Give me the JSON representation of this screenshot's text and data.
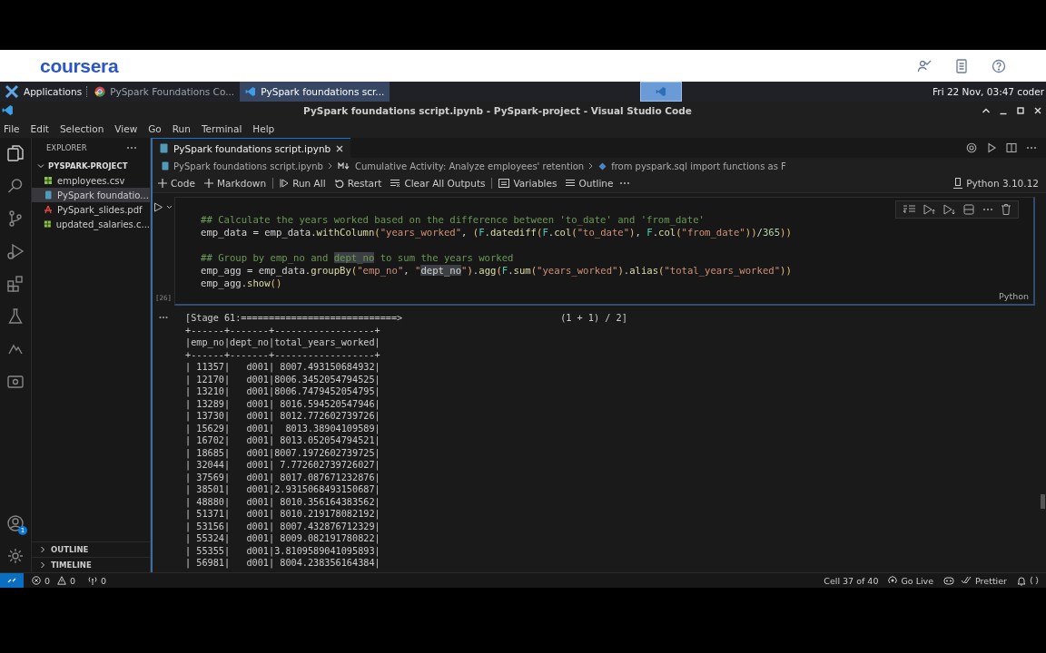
{
  "header": {
    "logo": "coursera"
  },
  "taskbar": {
    "apps_label": "Applications",
    "tasks": [
      {
        "label": "PySpark Foundations Co...",
        "kind": "browser",
        "selected": false
      },
      {
        "label": "PySpark foundations scr...",
        "kind": "editor",
        "selected": true
      }
    ],
    "clock": "Fri 22 Nov, 03:47 coder"
  },
  "window": {
    "title": "PySpark foundations script.ipynb - PySpark-project - Visual Studio Code"
  },
  "menu": [
    "File",
    "Edit",
    "Selection",
    "View",
    "Go",
    "Run",
    "Terminal",
    "Help"
  ],
  "activity_bar": {
    "account_badge": "1"
  },
  "sidebar": {
    "header": "EXPLORER",
    "project": "PYSPARK-PROJECT",
    "files": [
      {
        "name": "employees.csv",
        "kind": "csv",
        "selected": false
      },
      {
        "name": "PySpark foundatio...",
        "kind": "notebook",
        "selected": true
      },
      {
        "name": "PySpark_slides.pdf",
        "kind": "pdf",
        "selected": false
      },
      {
        "name": "updated_salaries.c...",
        "kind": "csv",
        "selected": false
      }
    ],
    "sections": [
      "OUTLINE",
      "TIMELINE"
    ]
  },
  "tabs": [
    {
      "label": "PySpark foundations script.ipynb",
      "selected": true
    }
  ],
  "breadcrumb": [
    "PySpark foundations script.ipynb",
    "Cumulative Activity: Analyze employees' retention",
    "from pyspark.sql import functions as F"
  ],
  "toolbar": [
    {
      "label": "Code",
      "kind": "plus"
    },
    {
      "label": "Markdown",
      "kind": "plus"
    },
    {
      "label": "Run All",
      "kind": "run"
    },
    {
      "label": "Restart",
      "kind": "restart"
    },
    {
      "label": "Clear All Outputs",
      "kind": "clear"
    },
    {
      "label": "Variables",
      "kind": "variables"
    },
    {
      "label": "Outline",
      "kind": "outline"
    }
  ],
  "kernel": "Python 3.10.12",
  "cell": {
    "execution_count": "[26]",
    "language": "Python",
    "code_blocks": [
      [
        [
          {
            "text": "## Calculate the years worked based on the difference between 'to_date' and 'from_date'",
            "kind": "comment"
          }
        ],
        [
          {
            "text": "emp_data = emp_data.",
            "kind": "plain"
          },
          {
            "text": "withColumn",
            "kind": "function"
          },
          {
            "text": "(",
            "kind": "bracket"
          },
          {
            "text": "\"years_worked\"",
            "kind": "string"
          },
          {
            "text": ", ",
            "kind": "plain"
          },
          {
            "text": "(",
            "kind": "bracket"
          },
          {
            "text": "F",
            "kind": "module"
          },
          {
            "text": ".",
            "kind": "plain"
          },
          {
            "text": "datediff",
            "kind": "function"
          },
          {
            "text": "(",
            "kind": "bracket"
          },
          {
            "text": "F",
            "kind": "module"
          },
          {
            "text": ".",
            "kind": "plain"
          },
          {
            "text": "col",
            "kind": "function"
          },
          {
            "text": "(",
            "kind": "bracket"
          },
          {
            "text": "\"to_date\"",
            "kind": "string"
          },
          {
            "text": ")",
            "kind": "bracket"
          },
          {
            "text": ", ",
            "kind": "plain"
          },
          {
            "text": "F",
            "kind": "module"
          },
          {
            "text": ".",
            "kind": "plain"
          },
          {
            "text": "col",
            "kind": "function"
          },
          {
            "text": "(",
            "kind": "bracket"
          },
          {
            "text": "\"from_date\"",
            "kind": "string"
          },
          {
            "text": "))",
            "kind": "bracket"
          },
          {
            "text": "/",
            "kind": "plain"
          },
          {
            "text": "365",
            "kind": "number"
          },
          {
            "text": "))",
            "kind": "bracket"
          }
        ]
      ],
      [
        [
          {
            "text": "## Group by emp_no and ",
            "kind": "comment"
          },
          {
            "text": "dept_no",
            "kind": "match-comment"
          },
          {
            "text": " to sum the years worked",
            "kind": "comment"
          }
        ],
        [
          {
            "text": "emp_agg = emp_data.",
            "kind": "plain"
          },
          {
            "text": "groupBy",
            "kind": "function"
          },
          {
            "text": "(",
            "kind": "bracket"
          },
          {
            "text": "\"emp_no\"",
            "kind": "string"
          },
          {
            "text": ", ",
            "kind": "plain"
          },
          {
            "text": "\"",
            "kind": "string"
          },
          {
            "text": "dept_no",
            "kind": "match-string"
          },
          {
            "text": "\"",
            "kind": "string"
          },
          {
            "text": ")",
            "kind": "bracket"
          },
          {
            "text": ".",
            "kind": "plain"
          },
          {
            "text": "agg",
            "kind": "function"
          },
          {
            "text": "(",
            "kind": "bracket"
          },
          {
            "text": "F",
            "kind": "module"
          },
          {
            "text": ".",
            "kind": "plain"
          },
          {
            "text": "sum",
            "kind": "function"
          },
          {
            "text": "(",
            "kind": "bracket"
          },
          {
            "text": "\"years_worked\"",
            "kind": "string"
          },
          {
            "text": ")",
            "kind": "bracket"
          },
          {
            "text": ".",
            "kind": "plain"
          },
          {
            "text": "alias",
            "kind": "function"
          },
          {
            "text": "(",
            "kind": "bracket"
          },
          {
            "text": "\"total_years_worked\"",
            "kind": "string"
          },
          {
            "text": "))",
            "kind": "bracket"
          }
        ],
        [
          {
            "text": "emp_agg.",
            "kind": "plain"
          },
          {
            "text": "show",
            "kind": "function"
          },
          {
            "text": "()",
            "kind": "bracket"
          }
        ]
      ]
    ]
  },
  "output": {
    "progress": "[Stage 61:============================>",
    "progress_count": "(1 + 1) / 2]",
    "lines": [
      "+------+-------+------------------+",
      "|emp_no|dept_no|total_years_worked|",
      "+------+-------+------------------+",
      "| 11357|   d001| 8007.493150684932|",
      "| 12170|   d001|8006.3452054794525|",
      "| 13210|   d001|8006.7479452054795|",
      "| 13289|   d001| 8016.594520547946|",
      "| 13730|   d001| 8012.772602739726|",
      "| 15629|   d001|  8013.38904109589|",
      "| 16702|   d001| 8013.052054794521|",
      "| 18685|   d001|8007.1972602739725|",
      "| 32044|   d001| 7.772602739726027|",
      "| 37569|   d001| 8017.087671232876|",
      "| 38501|   d001|2.9315068493150687|",
      "| 48880|   d001| 8010.356164383562|",
      "| 51371|   d001| 8010.219178082192|",
      "| 53156|   d001| 8007.432876712329|",
      "| 55324|   d001| 8009.082191780822|",
      "| 55355|   d001|3.8109589041095893|",
      "| 56981|   d001| 8004.238356164384|"
    ]
  },
  "status_bar": {
    "errors": "0",
    "warnings": "0",
    "ports": "0",
    "cell_position": "Cell 37 of 40",
    "go_live": "Go Live",
    "prettier": "Prettier"
  }
}
